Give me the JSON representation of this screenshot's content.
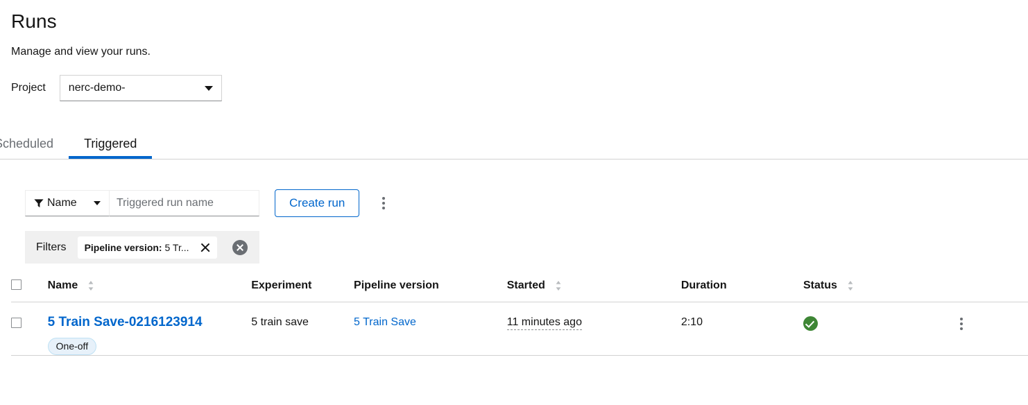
{
  "page": {
    "title": "Runs",
    "subtitle": "Manage and view your runs."
  },
  "project": {
    "label": "Project",
    "selected": "nerc-demo-",
    "caret_icon": "chevron-down-icon"
  },
  "tabs": [
    {
      "label": "Scheduled",
      "active": false
    },
    {
      "label": "Triggered",
      "active": true
    }
  ],
  "toolbar": {
    "filter_icon": "funnel-icon",
    "filter_attribute": "Name",
    "filter_caret_icon": "chevron-down-icon",
    "search_placeholder": "Triggered run name",
    "search_value": "",
    "create_run_label": "Create run",
    "kebab_icon": "kebab-vertical-icon"
  },
  "filters": {
    "label": "Filters",
    "chips": [
      {
        "prefix": "Pipeline version:",
        "value": "5 Tr...",
        "close_icon": "close-icon"
      }
    ],
    "clear_all_icon": "clear-all-circle-icon"
  },
  "table": {
    "columns": [
      {
        "key": "select",
        "label": "",
        "sortable": false,
        "sort_icon": ""
      },
      {
        "key": "name",
        "label": "Name",
        "sortable": true,
        "sort_icon": "sort-icon"
      },
      {
        "key": "experiment",
        "label": "Experiment",
        "sortable": false,
        "sort_icon": ""
      },
      {
        "key": "pipeline_version",
        "label": "Pipeline version",
        "sortable": false,
        "sort_icon": ""
      },
      {
        "key": "started",
        "label": "Started",
        "sortable": true,
        "sort_icon": "sort-icon"
      },
      {
        "key": "duration",
        "label": "Duration",
        "sortable": false,
        "sort_icon": ""
      },
      {
        "key": "status",
        "label": "Status",
        "sortable": true,
        "sort_icon": "sort-icon"
      },
      {
        "key": "actions",
        "label": "",
        "sortable": false,
        "sort_icon": ""
      }
    ],
    "rows": [
      {
        "selected": false,
        "name": "5 Train Save-0216123914",
        "badge": "One-off",
        "experiment": "5 train save",
        "pipeline_version": "5 Train Save",
        "started": "11 minutes ago",
        "duration": "2:10",
        "status": "succeeded",
        "status_icon": "check-circle-icon",
        "kebab_icon": "kebab-vertical-icon"
      }
    ]
  },
  "colors": {
    "link": "#0066cc",
    "accent": "#0066cc",
    "success": "#3e8635",
    "badge_bg": "#e7f1fa",
    "badge_border": "#bee1f4",
    "filters_bar_bg": "#f0f0f0",
    "border": "#d2d2d2",
    "muted_text": "#6a6e73"
  }
}
